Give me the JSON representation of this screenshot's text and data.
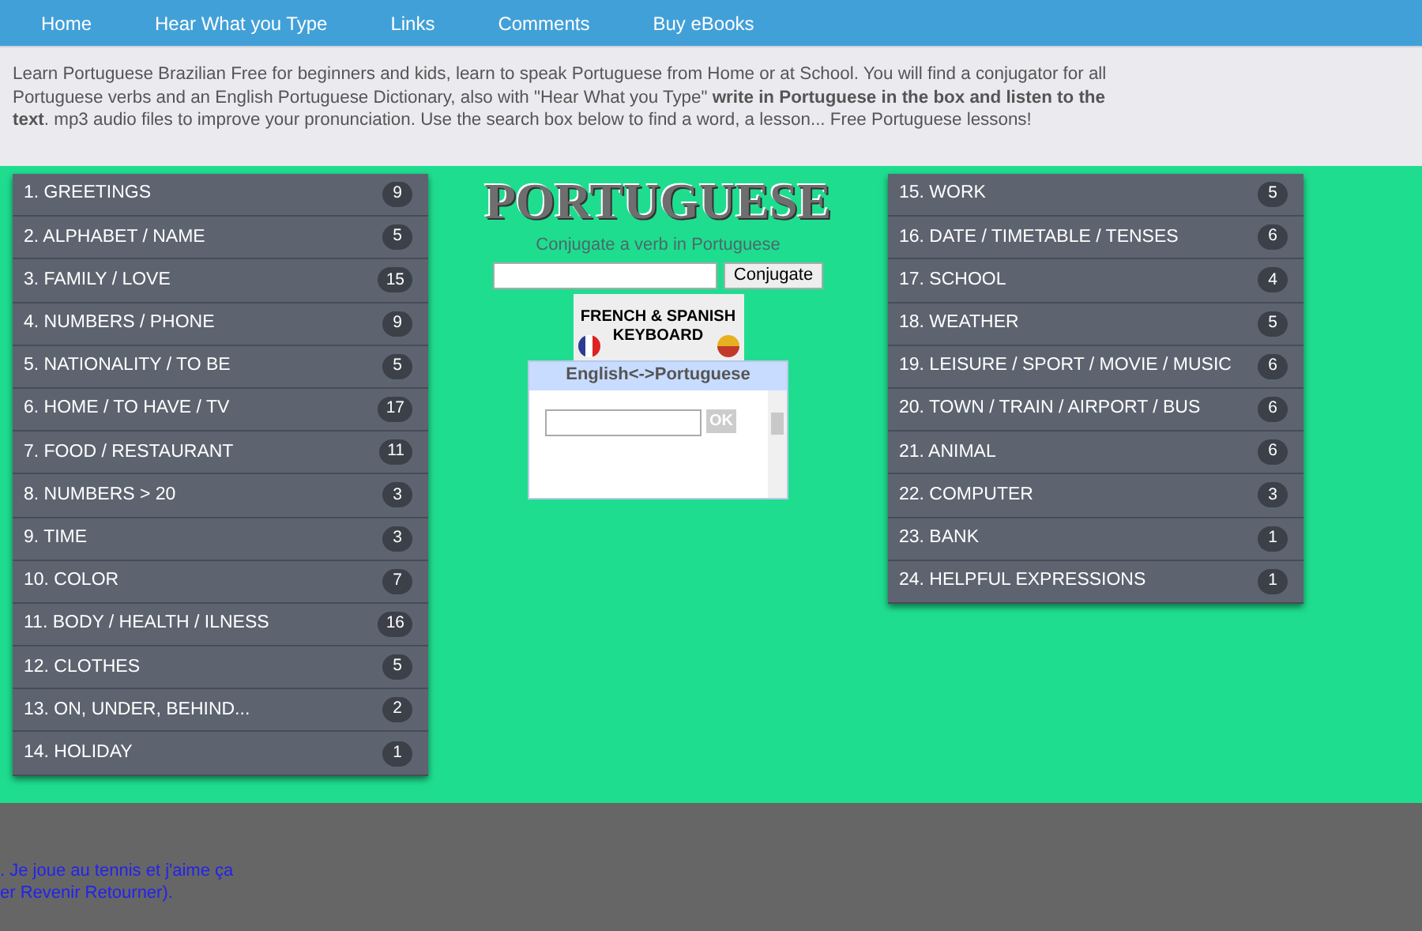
{
  "nav": [
    "Home",
    "Hear What you Type",
    "Links",
    "Comments",
    "Buy eBooks"
  ],
  "intro": "Learn Portuguese Brazilian Free for beginners and kids, learn to speak Portuguese from Home or at School. You will find a conjugator for all Portuguese verbs and an English Portuguese Dictionary, also with \"Hear What you Type\" **write in Portuguese in the box and listen to the text**. mp3 audio files to improve your pronunciation. Use the search box below to find a word, a lesson... Free Portuguese lessons!",
  "left_menu": [
    {
      "label": "1. GREETINGS",
      "count": "9"
    },
    {
      "label": "2. ALPHABET / NAME",
      "count": "5"
    },
    {
      "label": "3. FAMILY / LOVE",
      "count": "15"
    },
    {
      "label": "4. NUMBERS / PHONE",
      "count": "9"
    },
    {
      "label": "5. NATIONALITY / TO BE",
      "count": "5"
    },
    {
      "label": "6. HOME / TO HAVE / TV",
      "count": "17"
    },
    {
      "label": "7. FOOD / RESTAURANT",
      "count": "11"
    },
    {
      "label": "8. NUMBERS > 20",
      "count": "3"
    },
    {
      "label": "9. TIME",
      "count": "3"
    },
    {
      "label": "10. COLOR",
      "count": "7"
    },
    {
      "label": "11. BODY / HEALTH / ILNESS",
      "count": "16"
    },
    {
      "label": "12. CLOTHES",
      "count": "5"
    },
    {
      "label": "13. ON, UNDER, BEHIND...",
      "count": "2"
    },
    {
      "label": "14. HOLIDAY",
      "count": "1"
    }
  ],
  "center": {
    "title": "PORTUGUESE",
    "conjugate_label": "Conjugate a verb in Portuguese",
    "conjugate_button": "Conjugate",
    "keyboard_banner": [
      "FRENCH & SPANISH",
      "KEYBOARD"
    ],
    "dictionary": {
      "title": "English<->Portuguese",
      "button": "OK"
    }
  },
  "right_menu": [
    {
      "label": "15. WORK",
      "count": "5"
    },
    {
      "label": "16. DATE / TIMETABLE / TENSES",
      "count": "6"
    },
    {
      "label": "17. SCHOOL",
      "count": "4"
    },
    {
      "label": "18. WEATHER",
      "count": "5"
    },
    {
      "label": "19. LEISURE / SPORT / MOVIE / MUSIC",
      "count": "6"
    },
    {
      "label": "20. TOWN / TRAIN / AIRPORT / BUS",
      "count": "6"
    },
    {
      "label": "21. ANIMAL",
      "count": "6"
    },
    {
      "label": "22. COMPUTER",
      "count": "3"
    },
    {
      "label": "23. BANK",
      "count": "1"
    },
    {
      "label": "24. HELPFUL EXPRESSIONS",
      "count": "1"
    }
  ],
  "footer_lines": [
    ". Je joue au tennis et j'aime ça",
    "er Revenir Retourner)."
  ]
}
